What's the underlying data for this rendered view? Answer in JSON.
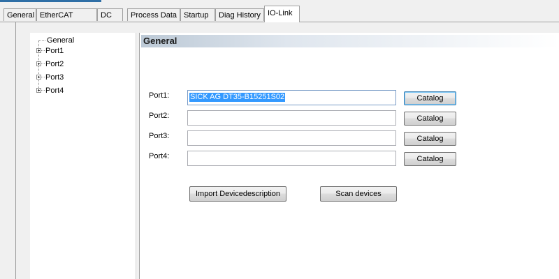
{
  "tabs": [
    {
      "label": "General"
    },
    {
      "label": "EtherCAT"
    },
    {
      "label": "DC"
    },
    {
      "label": "Process Data"
    },
    {
      "label": "Startup"
    },
    {
      "label": "Diag History"
    },
    {
      "label": "IO-Link",
      "active": true
    }
  ],
  "tree": {
    "items": [
      "General",
      "Port1",
      "Port2",
      "Port3",
      "Port4"
    ]
  },
  "panel": {
    "header": "General",
    "ports": [
      {
        "label": "Port1:",
        "value": "SICK AG  DT35-B15251S02",
        "selected": true
      },
      {
        "label": "Port2:",
        "value": ""
      },
      {
        "label": "Port3:",
        "value": ""
      },
      {
        "label": "Port4:",
        "value": ""
      }
    ],
    "catalog_label": "Catalog",
    "import_label": "Import Devicedescription",
    "scan_label": "Scan devices"
  },
  "colors": {
    "accent": "#2f6fa6",
    "selection": "#3399ff",
    "panel_bg": "#f0f0f0"
  }
}
